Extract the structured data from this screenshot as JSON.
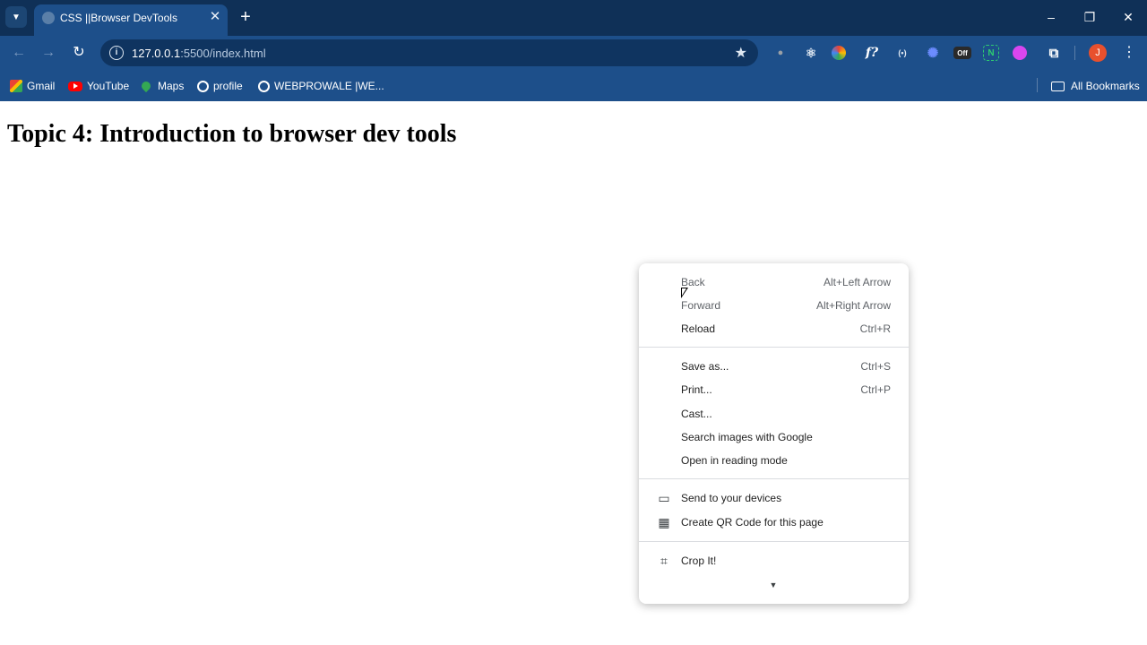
{
  "browser": {
    "tab": {
      "title": "CSS ||Browser DevTools"
    },
    "address": {
      "host": "127.0.0.1",
      "path": ":5500/index.html"
    },
    "bookmarks": [
      {
        "label": "Gmail",
        "icon": "gmail-icon"
      },
      {
        "label": "YouTube",
        "icon": "youtube-icon"
      },
      {
        "label": "Maps",
        "icon": "maps-icon"
      },
      {
        "label": "profile",
        "icon": "globe-icon"
      },
      {
        "label": "WEBPROWALE |WE...",
        "icon": "globe-icon"
      }
    ],
    "all_bookmarks_label": "All Bookmarks",
    "profile_initial": "J",
    "extension_badge": "Off"
  },
  "page": {
    "heading": "Topic 4: Introduction to browser dev tools"
  },
  "context_menu": {
    "group1": [
      {
        "label": "Back",
        "shortcut": "Alt+Left Arrow"
      },
      {
        "label": "Forward",
        "shortcut": "Alt+Right Arrow"
      },
      {
        "label": "Reload",
        "shortcut": "Ctrl+R"
      }
    ],
    "group2": [
      {
        "label": "Save as...",
        "shortcut": "Ctrl+S"
      },
      {
        "label": "Print...",
        "shortcut": "Ctrl+P"
      },
      {
        "label": "Cast...",
        "shortcut": ""
      },
      {
        "label": "Search images with Google",
        "shortcut": ""
      },
      {
        "label": "Open in reading mode",
        "shortcut": ""
      }
    ],
    "group3": [
      {
        "label": "Send to your devices",
        "icon": "send-to-devices-icon"
      },
      {
        "label": "Create QR Code for this page",
        "icon": "qr-code-icon"
      }
    ],
    "group4": [
      {
        "label": "Crop It!",
        "icon": "crop-icon"
      }
    ]
  },
  "colors": {
    "frame": "#0f3057",
    "toolbar": "#1d4f8a",
    "omnibox": "#0f3460",
    "menu_background": "#ffffff"
  }
}
